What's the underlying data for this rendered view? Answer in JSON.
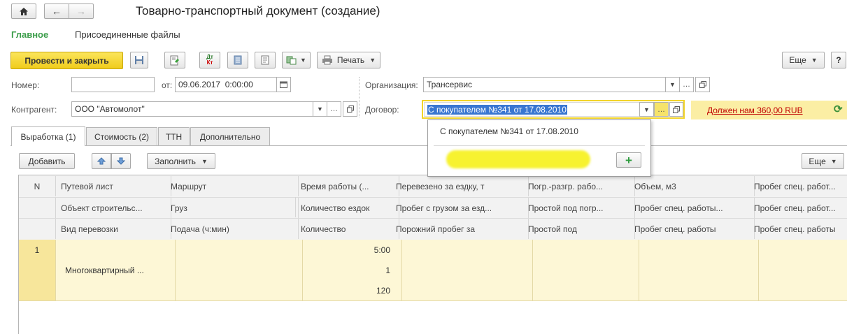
{
  "window": {
    "title": "Товарно-транспортный документ (создание)"
  },
  "nav_tabs": [
    {
      "label": "Главное"
    },
    {
      "label": "Присоединенные файлы"
    }
  ],
  "toolbar": {
    "post_close": "Провести и закрыть",
    "print": "Печать",
    "more": "Еще",
    "help": "?"
  },
  "form": {
    "number_label": "Номер:",
    "number_value": "",
    "date_label": "от:",
    "date_value": "09.06.2017  0:00:00",
    "org_label": "Организация:",
    "org_value": "Трансервис",
    "contractor_label": "Контрагент:",
    "contractor_value": "ООО \"Автомолот\"",
    "contract_label": "Договор:",
    "contract_value": "С покупателем №341 от 17.08.2010",
    "debt_text": "Должен нам 360,00 RUB"
  },
  "dropdown": {
    "item": "С покупателем №341 от 17.08.2010"
  },
  "section_tabs": [
    {
      "label": "Выработка (1)"
    },
    {
      "label": "Стоимость (2)"
    },
    {
      "label": "ТТН"
    },
    {
      "label": "Дополнительно"
    }
  ],
  "table_toolbar": {
    "add": "Добавить",
    "fill": "Заполнить",
    "more": "Еще"
  },
  "table": {
    "header_rows": [
      [
        "N",
        "Путевой лист",
        "Маршрут",
        "Время работы (...",
        "Перевезено за ездку, т",
        "Погр.-разгр. рабо...",
        "Объем, м3",
        "Пробег спец. работ..."
      ],
      [
        "",
        "Объект строительс...",
        "Груз",
        "Количество ездок",
        "Пробег с грузом за езд...",
        "Простой под погр...",
        "Пробег спец. работы...",
        "Пробег спец. работ..."
      ],
      [
        "",
        "Вид перевозки",
        "Подача (ч:мин)",
        "Количество",
        "Порожний пробег за",
        "Простой под",
        "Пробег спец. работы",
        "Пробег спец. работы"
      ]
    ],
    "data_rows": [
      [
        "1",
        "",
        "",
        "5:00",
        "",
        "",
        "",
        ""
      ],
      [
        "",
        "Многоквартирный ...",
        "",
        "1",
        "",
        "",
        "",
        ""
      ],
      [
        "",
        "",
        "",
        "120",
        "",
        "",
        "",
        ""
      ]
    ]
  },
  "colors": {
    "accent_yellow": "#f5d82e",
    "nav_green": "#3b9d4a",
    "row_highlight": "#fdf7d6",
    "debt_red": "#c00000"
  }
}
